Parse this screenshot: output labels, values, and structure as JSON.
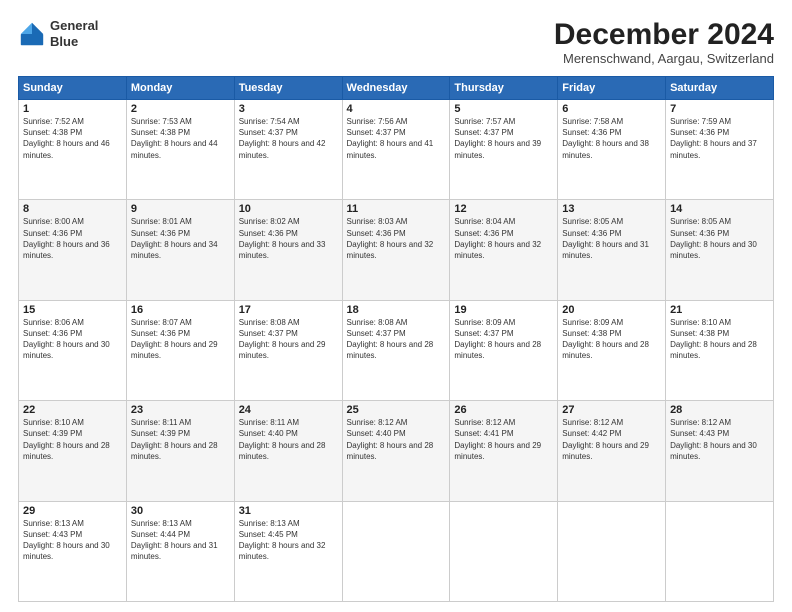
{
  "logo": {
    "line1": "General",
    "line2": "Blue"
  },
  "title": "December 2024",
  "location": "Merenschwand, Aargau, Switzerland",
  "days_of_week": [
    "Sunday",
    "Monday",
    "Tuesday",
    "Wednesday",
    "Thursday",
    "Friday",
    "Saturday"
  ],
  "weeks": [
    [
      {
        "day": "1",
        "sunrise": "Sunrise: 7:52 AM",
        "sunset": "Sunset: 4:38 PM",
        "daylight": "Daylight: 8 hours and 46 minutes."
      },
      {
        "day": "2",
        "sunrise": "Sunrise: 7:53 AM",
        "sunset": "Sunset: 4:38 PM",
        "daylight": "Daylight: 8 hours and 44 minutes."
      },
      {
        "day": "3",
        "sunrise": "Sunrise: 7:54 AM",
        "sunset": "Sunset: 4:37 PM",
        "daylight": "Daylight: 8 hours and 42 minutes."
      },
      {
        "day": "4",
        "sunrise": "Sunrise: 7:56 AM",
        "sunset": "Sunset: 4:37 PM",
        "daylight": "Daylight: 8 hours and 41 minutes."
      },
      {
        "day": "5",
        "sunrise": "Sunrise: 7:57 AM",
        "sunset": "Sunset: 4:37 PM",
        "daylight": "Daylight: 8 hours and 39 minutes."
      },
      {
        "day": "6",
        "sunrise": "Sunrise: 7:58 AM",
        "sunset": "Sunset: 4:36 PM",
        "daylight": "Daylight: 8 hours and 38 minutes."
      },
      {
        "day": "7",
        "sunrise": "Sunrise: 7:59 AM",
        "sunset": "Sunset: 4:36 PM",
        "daylight": "Daylight: 8 hours and 37 minutes."
      }
    ],
    [
      {
        "day": "8",
        "sunrise": "Sunrise: 8:00 AM",
        "sunset": "Sunset: 4:36 PM",
        "daylight": "Daylight: 8 hours and 36 minutes."
      },
      {
        "day": "9",
        "sunrise": "Sunrise: 8:01 AM",
        "sunset": "Sunset: 4:36 PM",
        "daylight": "Daylight: 8 hours and 34 minutes."
      },
      {
        "day": "10",
        "sunrise": "Sunrise: 8:02 AM",
        "sunset": "Sunset: 4:36 PM",
        "daylight": "Daylight: 8 hours and 33 minutes."
      },
      {
        "day": "11",
        "sunrise": "Sunrise: 8:03 AM",
        "sunset": "Sunset: 4:36 PM",
        "daylight": "Daylight: 8 hours and 32 minutes."
      },
      {
        "day": "12",
        "sunrise": "Sunrise: 8:04 AM",
        "sunset": "Sunset: 4:36 PM",
        "daylight": "Daylight: 8 hours and 32 minutes."
      },
      {
        "day": "13",
        "sunrise": "Sunrise: 8:05 AM",
        "sunset": "Sunset: 4:36 PM",
        "daylight": "Daylight: 8 hours and 31 minutes."
      },
      {
        "day": "14",
        "sunrise": "Sunrise: 8:05 AM",
        "sunset": "Sunset: 4:36 PM",
        "daylight": "Daylight: 8 hours and 30 minutes."
      }
    ],
    [
      {
        "day": "15",
        "sunrise": "Sunrise: 8:06 AM",
        "sunset": "Sunset: 4:36 PM",
        "daylight": "Daylight: 8 hours and 30 minutes."
      },
      {
        "day": "16",
        "sunrise": "Sunrise: 8:07 AM",
        "sunset": "Sunset: 4:36 PM",
        "daylight": "Daylight: 8 hours and 29 minutes."
      },
      {
        "day": "17",
        "sunrise": "Sunrise: 8:08 AM",
        "sunset": "Sunset: 4:37 PM",
        "daylight": "Daylight: 8 hours and 29 minutes."
      },
      {
        "day": "18",
        "sunrise": "Sunrise: 8:08 AM",
        "sunset": "Sunset: 4:37 PM",
        "daylight": "Daylight: 8 hours and 28 minutes."
      },
      {
        "day": "19",
        "sunrise": "Sunrise: 8:09 AM",
        "sunset": "Sunset: 4:37 PM",
        "daylight": "Daylight: 8 hours and 28 minutes."
      },
      {
        "day": "20",
        "sunrise": "Sunrise: 8:09 AM",
        "sunset": "Sunset: 4:38 PM",
        "daylight": "Daylight: 8 hours and 28 minutes."
      },
      {
        "day": "21",
        "sunrise": "Sunrise: 8:10 AM",
        "sunset": "Sunset: 4:38 PM",
        "daylight": "Daylight: 8 hours and 28 minutes."
      }
    ],
    [
      {
        "day": "22",
        "sunrise": "Sunrise: 8:10 AM",
        "sunset": "Sunset: 4:39 PM",
        "daylight": "Daylight: 8 hours and 28 minutes."
      },
      {
        "day": "23",
        "sunrise": "Sunrise: 8:11 AM",
        "sunset": "Sunset: 4:39 PM",
        "daylight": "Daylight: 8 hours and 28 minutes."
      },
      {
        "day": "24",
        "sunrise": "Sunrise: 8:11 AM",
        "sunset": "Sunset: 4:40 PM",
        "daylight": "Daylight: 8 hours and 28 minutes."
      },
      {
        "day": "25",
        "sunrise": "Sunrise: 8:12 AM",
        "sunset": "Sunset: 4:40 PM",
        "daylight": "Daylight: 8 hours and 28 minutes."
      },
      {
        "day": "26",
        "sunrise": "Sunrise: 8:12 AM",
        "sunset": "Sunset: 4:41 PM",
        "daylight": "Daylight: 8 hours and 29 minutes."
      },
      {
        "day": "27",
        "sunrise": "Sunrise: 8:12 AM",
        "sunset": "Sunset: 4:42 PM",
        "daylight": "Daylight: 8 hours and 29 minutes."
      },
      {
        "day": "28",
        "sunrise": "Sunrise: 8:12 AM",
        "sunset": "Sunset: 4:43 PM",
        "daylight": "Daylight: 8 hours and 30 minutes."
      }
    ],
    [
      {
        "day": "29",
        "sunrise": "Sunrise: 8:13 AM",
        "sunset": "Sunset: 4:43 PM",
        "daylight": "Daylight: 8 hours and 30 minutes."
      },
      {
        "day": "30",
        "sunrise": "Sunrise: 8:13 AM",
        "sunset": "Sunset: 4:44 PM",
        "daylight": "Daylight: 8 hours and 31 minutes."
      },
      {
        "day": "31",
        "sunrise": "Sunrise: 8:13 AM",
        "sunset": "Sunset: 4:45 PM",
        "daylight": "Daylight: 8 hours and 32 minutes."
      },
      null,
      null,
      null,
      null
    ]
  ]
}
